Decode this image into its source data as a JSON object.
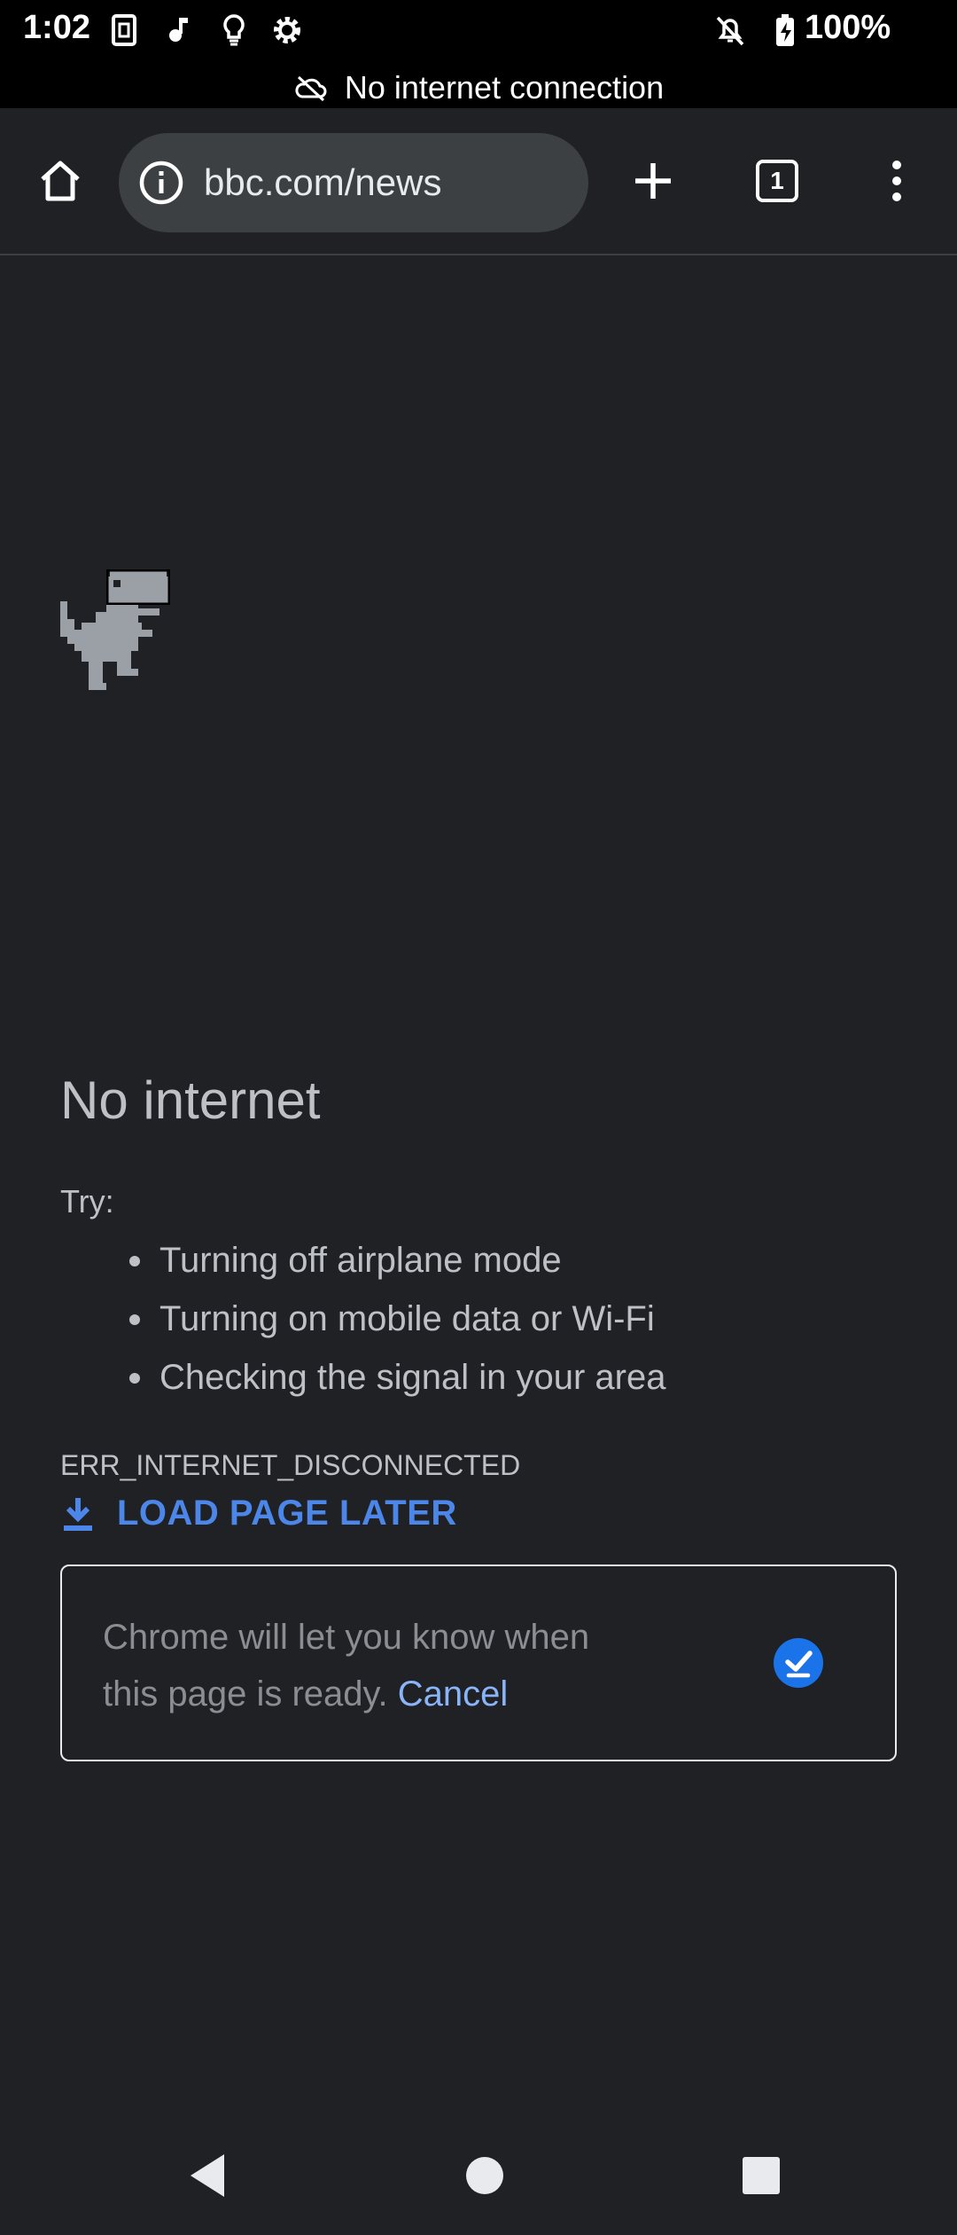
{
  "status_bar": {
    "time": "1:02",
    "battery": "100%",
    "connection_banner": "No internet connection",
    "icons": [
      "sim-card-icon",
      "music-note-icon",
      "lightbulb-icon",
      "settings-gear-icon",
      "notifications-off-icon",
      "battery-charging-icon",
      "cloud-off-icon"
    ]
  },
  "toolbar": {
    "url": "bbc.com/news",
    "tab_count": "1",
    "icons": [
      "home-icon",
      "info-icon",
      "plus-icon",
      "tab-switcher-icon",
      "more-vert-icon"
    ]
  },
  "error_page": {
    "heading": "No internet",
    "try_label": "Try:",
    "suggestions": [
      "Turning off airplane mode",
      "Turning on mobile data or Wi-Fi",
      "Checking the signal in your area"
    ],
    "error_code": "ERR_INTERNET_DISCONNECTED",
    "load_later_label": "LOAD PAGE LATER",
    "notice_text": "Chrome will let you know when this page is ready.",
    "cancel_label": "Cancel",
    "icons": [
      "offline-dino-icon",
      "download-icon",
      "scheduled-check-icon"
    ]
  },
  "navigation_bar": {
    "icons": [
      "back-icon",
      "home-nav-icon",
      "recents-icon"
    ]
  },
  "colors": {
    "background": "#202124",
    "status_bar": "#000000",
    "omnibox": "#3c4043",
    "accent_blue": "#4b86e8",
    "link_blue": "#8ab4f8",
    "text": "#bdc1c6"
  }
}
